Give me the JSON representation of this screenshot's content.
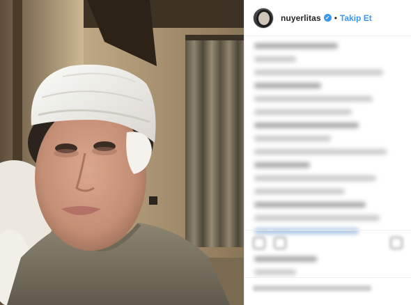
{
  "post": {
    "username": "nuyerlitas",
    "verified_mark": "✓",
    "separator": "•",
    "follow_label": "Takip Et",
    "verified_icon": "verified-badge-icon",
    "photo_subject": "post-photo",
    "colors": {
      "accent": "#3897f0",
      "text": "#262626",
      "border": "#efefef"
    }
  }
}
